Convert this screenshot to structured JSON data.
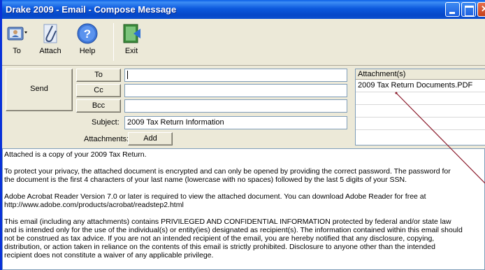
{
  "window": {
    "title": "Drake 2009 - Email - Compose Message"
  },
  "toolbar": {
    "to_label": "To",
    "attach_label": "Attach",
    "help_label": "Help",
    "exit_label": "Exit"
  },
  "compose": {
    "send_label": "Send",
    "to_button": "To",
    "cc_button": "Cc",
    "bcc_button": "Bcc",
    "to_value": "",
    "cc_value": "",
    "bcc_value": "",
    "subject_label": "Subject:",
    "subject_value": "2009 Tax Return Information",
    "attachments_label": "Attachments:",
    "add_label": "Add"
  },
  "attachments": {
    "header": "Attachment(s)",
    "files": [
      "2009 Tax Return Documents.PDF"
    ]
  },
  "message": {
    "paragraphs": [
      "Attached is a copy of your 2009 Tax Return.",
      "To protect your privacy, the attached document is encrypted and can only be opened by providing the correct password. The password for\nthe document is the first 4 characters of your last name (lowercase with no spaces) followed by the last 5 digits of your SSN.",
      "Adobe Acrobat Reader Version 7.0 or later is required to view the attached document. You can download Adobe Reader for free at\nhttp://www.adobe.com/products/acrobat/readstep2.html",
      "This email (including any attachments) contains PRIVILEGED AND CONFIDENTIAL INFORMATION protected by federal and/or state law\nand is intended only for the use of the individual(s) or entity(ies) designated as recipient(s). The information contained within this email should\nnot be construed as tax advice. If you are not an intended recipient of the email, you are hereby notified that any disclosure, copying,\ndistribution, or action taken in reliance on the contents of this email is strictly prohibited. Disclosure to anyone other than the intended\nrecipient does not constitute a waiver of any applicable privilege."
    ]
  },
  "colors": {
    "titlebar": "#0a5fe6",
    "window_bg": "#ece9d8",
    "callout_line": "#8b1a2b"
  },
  "icons": [
    "address-book-icon",
    "paperclip-icon",
    "help-icon",
    "exit-icon",
    "minimize-icon",
    "maximize-icon",
    "close-icon"
  ]
}
